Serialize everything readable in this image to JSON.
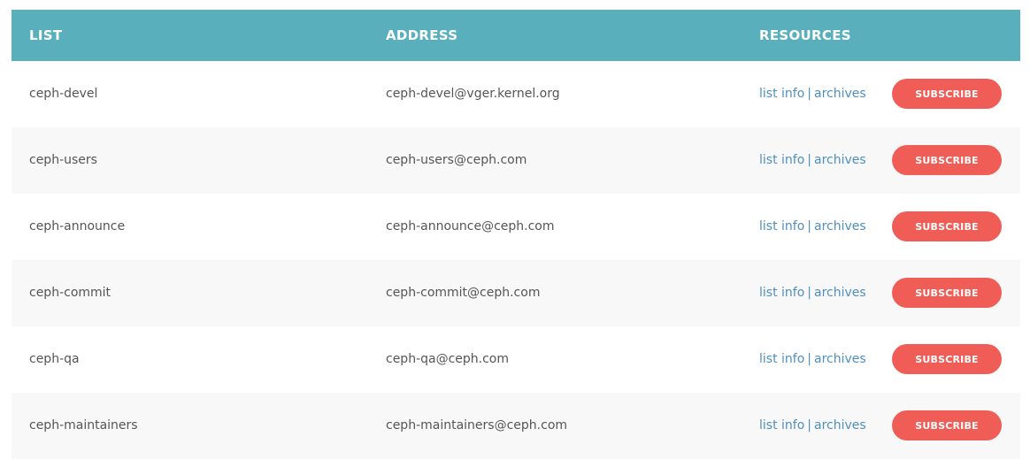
{
  "header": {
    "list": "LIST",
    "address": "ADDRESS",
    "resources": "RESOURCES"
  },
  "links": {
    "list_info": "list info",
    "separator": "|",
    "archives": "archives"
  },
  "subscribe_label": "SUBSCRIBE",
  "colors": {
    "header_bg": "#5aafbc",
    "button_bg": "#f05c56",
    "link": "#4f8fbf",
    "alt_row": "#f8f8f8"
  },
  "rows": [
    {
      "list": "ceph-devel",
      "address": "ceph-devel@vger.kernel.org"
    },
    {
      "list": "ceph-users",
      "address": "ceph-users@ceph.com"
    },
    {
      "list": "ceph-announce",
      "address": "ceph-announce@ceph.com"
    },
    {
      "list": "ceph-commit",
      "address": "ceph-commit@ceph.com"
    },
    {
      "list": "ceph-qa",
      "address": "ceph-qa@ceph.com"
    },
    {
      "list": "ceph-maintainers",
      "address": "ceph-maintainers@ceph.com"
    }
  ]
}
